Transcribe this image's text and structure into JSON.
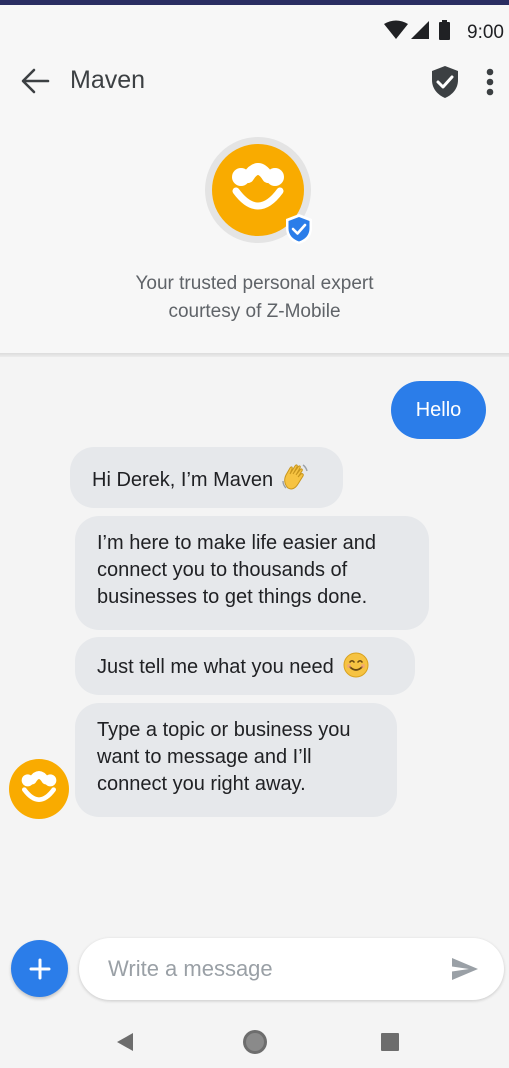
{
  "status_bar": {
    "time": "9:00"
  },
  "header": {
    "title": "Maven"
  },
  "profile": {
    "tagline_line1": "Your trusted personal expert",
    "tagline_line2": "courtesy of Z-Mobile"
  },
  "messages": {
    "outgoing_1": "Hello",
    "incoming_1": "Hi Derek, I’m Maven",
    "incoming_2": [
      "I’m here to make life easier and",
      "connect you to thousands of",
      "businesses to get things done."
    ],
    "incoming_3": "Just tell me what you need",
    "incoming_4": [
      "Type a topic or business you",
      "want to message and I’ll",
      "connect you right away."
    ]
  },
  "composer": {
    "placeholder": "Write a message"
  },
  "colors": {
    "brand_orange": "#f9ab00",
    "accent_blue": "#2b7de9",
    "incoming_bubble": "#e6e8eb",
    "background": "#f4f4f4"
  },
  "icons": [
    "wifi-icon",
    "signal-icon",
    "battery-icon",
    "back-arrow-icon",
    "shield-check-icon",
    "more-vert-icon",
    "maven-logo-icon",
    "verified-badge-icon",
    "waving-hand-emoji",
    "smile-emoji",
    "plus-icon",
    "send-icon",
    "nav-back-icon",
    "nav-home-icon",
    "nav-recents-icon"
  ]
}
